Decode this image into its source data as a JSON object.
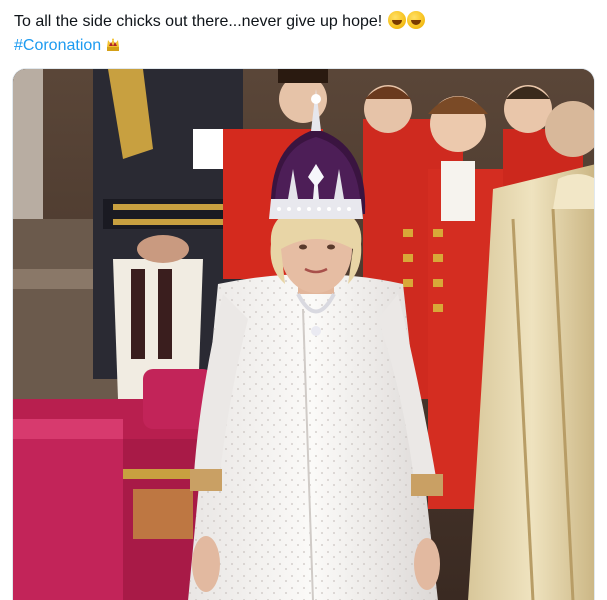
{
  "tweet": {
    "line1": "To all the side chicks out there...never give up hope!",
    "line1_emojis": [
      "rolling-on-floor-laughing-emoji",
      "rolling-on-floor-laughing-emoji"
    ],
    "hashtag": "#Coronation",
    "hashtag_emoji": "crown-emoji",
    "hashtag_color": "#1d9bf0",
    "text_color": "#0f1419"
  },
  "media": {
    "subject": "photo-coronation-ceremony"
  }
}
